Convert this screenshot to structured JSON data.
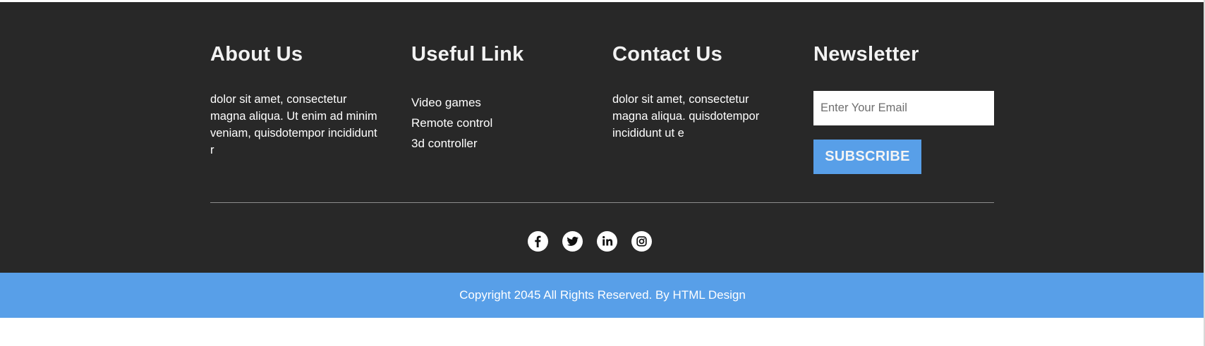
{
  "about": {
    "heading": "About Us",
    "text": "dolor sit amet, consectetur magna aliqua. Ut enim ad minim veniam, quisdotempor incididunt r"
  },
  "useful_links": {
    "heading": "Useful Link",
    "items": [
      {
        "label": "Video games"
      },
      {
        "label": "Remote control"
      },
      {
        "label": "3d controller"
      }
    ]
  },
  "contact": {
    "heading": "Contact Us",
    "text": "dolor sit amet, consectetur magna aliqua. quisdotempor incididunt ut e"
  },
  "newsletter": {
    "heading": "Newsletter",
    "email_placeholder": "Enter Your Email",
    "email_value": "",
    "subscribe_label": "SUBSCRIBE"
  },
  "social": [
    {
      "name": "facebook",
      "icon": "facebook-icon"
    },
    {
      "name": "twitter",
      "icon": "twitter-icon"
    },
    {
      "name": "linkedin",
      "icon": "linkedin-icon"
    },
    {
      "name": "instagram",
      "icon": "instagram-icon"
    }
  ],
  "copyright": {
    "text": "Copyright 2045 All Rights Reserved. By ",
    "link_label": "HTML Design"
  },
  "colors": {
    "footer_bg": "#282828",
    "accent": "#589fe8",
    "text": "#ffffff"
  }
}
